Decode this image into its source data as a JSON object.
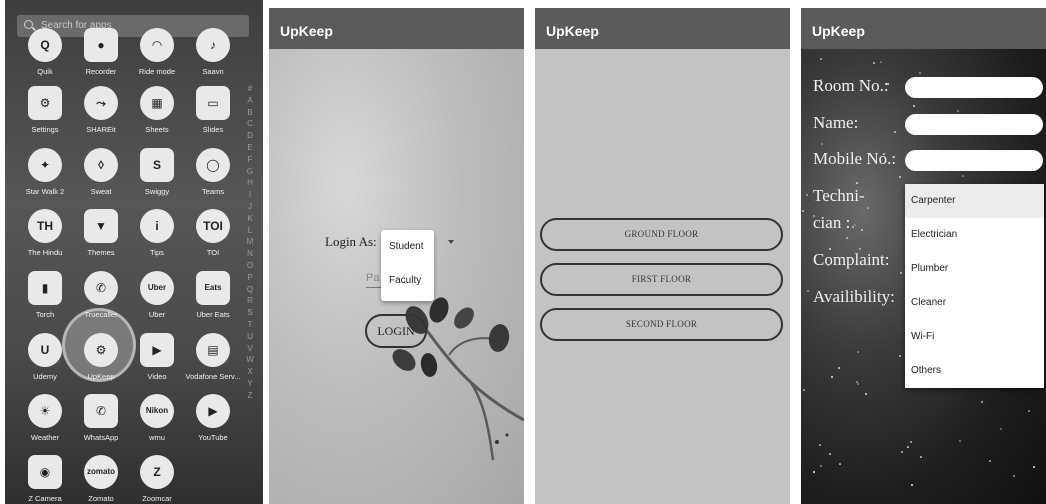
{
  "drawer": {
    "search_placeholder": "Search for apps",
    "alphabet": [
      "#",
      "A",
      "B",
      "C",
      "D",
      "E",
      "F",
      "G",
      "H",
      "I",
      "J",
      "K",
      "L",
      "M",
      "N",
      "O",
      "P",
      "Q",
      "R",
      "S",
      "T",
      "U",
      "V",
      "W",
      "X",
      "Y",
      "Z"
    ],
    "apps": [
      {
        "label": "Quik",
        "icon": "quik-icon",
        "glyph": "Q"
      },
      {
        "label": "Recorder",
        "icon": "recorder-icon",
        "glyph": "●"
      },
      {
        "label": "Ride mode",
        "icon": "ride-mode-icon",
        "glyph": "◠"
      },
      {
        "label": "Saavn",
        "icon": "saavn-icon",
        "glyph": "♪"
      },
      {
        "label": "Settings",
        "icon": "settings-icon",
        "glyph": "⚙"
      },
      {
        "label": "SHAREit",
        "icon": "shareit-icon",
        "glyph": "⤳"
      },
      {
        "label": "Sheets",
        "icon": "sheets-icon",
        "glyph": "▦"
      },
      {
        "label": "Slides",
        "icon": "slides-icon",
        "glyph": "▭"
      },
      {
        "label": "Star Walk 2",
        "icon": "star-walk-icon",
        "glyph": "✦"
      },
      {
        "label": "Sweat",
        "icon": "sweat-icon",
        "glyph": "◊"
      },
      {
        "label": "Swiggy",
        "icon": "swiggy-icon",
        "glyph": "S"
      },
      {
        "label": "Teams",
        "icon": "teams-icon",
        "glyph": "◯"
      },
      {
        "label": "The Hindu",
        "icon": "the-hindu-icon",
        "glyph": "TH"
      },
      {
        "label": "Themes",
        "icon": "themes-icon",
        "glyph": "▼"
      },
      {
        "label": "Tips",
        "icon": "tips-icon",
        "glyph": "i"
      },
      {
        "label": "TOI",
        "icon": "toi-icon",
        "glyph": "TOI"
      },
      {
        "label": "Torch",
        "icon": "torch-icon",
        "glyph": "▮"
      },
      {
        "label": "Truecaller",
        "icon": "truecaller-icon",
        "glyph": "✆"
      },
      {
        "label": "Uber",
        "icon": "uber-icon",
        "glyph": "Uber"
      },
      {
        "label": "Uber Eats",
        "icon": "uber-eats-icon",
        "glyph": "Eats"
      },
      {
        "label": "Udemy",
        "icon": "udemy-icon",
        "glyph": "U"
      },
      {
        "label": "UpKeep",
        "icon": "upkeep-icon",
        "glyph": "⚙"
      },
      {
        "label": "Video",
        "icon": "video-icon",
        "glyph": "▶"
      },
      {
        "label": "Vodafone Serv...",
        "icon": "vodafone-icon",
        "glyph": "▤"
      },
      {
        "label": "Weather",
        "icon": "weather-icon",
        "glyph": "☀"
      },
      {
        "label": "WhatsApp",
        "icon": "whatsapp-icon",
        "glyph": "✆"
      },
      {
        "label": "wmu",
        "icon": "wmu-icon",
        "glyph": "Nikon"
      },
      {
        "label": "YouTube",
        "icon": "youtube-icon",
        "glyph": "▶"
      },
      {
        "label": "Z Camera",
        "icon": "z-camera-icon",
        "glyph": "◉"
      },
      {
        "label": "Zomato",
        "icon": "zomato-icon",
        "glyph": "zomato"
      },
      {
        "label": "Zoomcar",
        "icon": "zoomcar-icon",
        "glyph": "Z"
      }
    ]
  },
  "login": {
    "app_title": "UpKeep",
    "login_as_label": "Login As:",
    "password_hint": "Pa",
    "dropdown_options": [
      "Student",
      "Faculty"
    ],
    "login_button": "LOGIN"
  },
  "floors": {
    "app_title": "UpKeep",
    "buttons": [
      "GROUND FLOOR",
      "FIRST FLOOR",
      "SECOND FLOOR"
    ]
  },
  "complaint": {
    "app_title": "UpKeep",
    "labels": {
      "room": "Room No.:",
      "name": "Name:",
      "mobile": "Mobile No.:",
      "technician_1": "Techni-",
      "technician_2": "cian :",
      "complaint": "Complaint:",
      "availability": "Availibility:"
    },
    "technician_options": [
      "Carpenter",
      "Electrician",
      "Plumber",
      "Cleaner",
      "Wi-Fi",
      "Others"
    ],
    "highlighted_option": "Carpenter"
  },
  "colors": {
    "appbar": "#5a5a5a",
    "drawer_bg": "#4a4a4a",
    "floor_bg": "#c3c3c3",
    "form_bg": "#1d1d1d"
  }
}
